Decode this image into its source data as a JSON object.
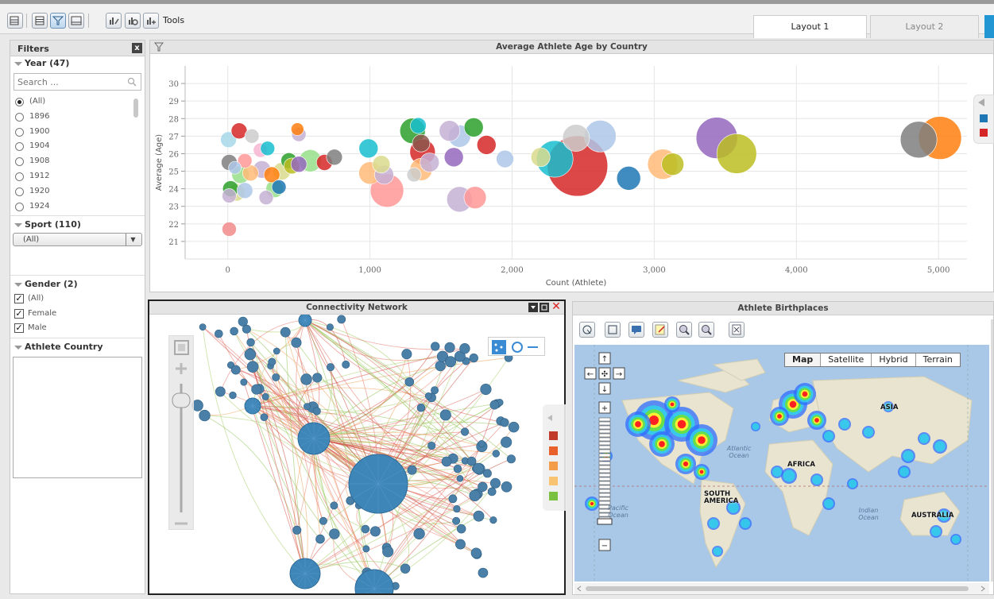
{
  "toolbar": {
    "tools_label": "Tools"
  },
  "tabs": [
    {
      "label": "Layout 1",
      "active": true
    },
    {
      "label": "Layout 2",
      "active": false
    }
  ],
  "filters": {
    "title": "Filters",
    "close": "x",
    "year": {
      "header": "Year (47)",
      "search_placeholder": "Search ...",
      "options": [
        "(All)",
        "1896",
        "1900",
        "1904",
        "1908",
        "1912",
        "1920",
        "1924"
      ],
      "selected": "(All)"
    },
    "sport": {
      "header": "Sport (110)",
      "selected": "(All)"
    },
    "gender": {
      "header": "Gender (2)",
      "options": [
        "(All)",
        "Female",
        "Male"
      ]
    },
    "athlete_country": {
      "header": "Athlete Country"
    }
  },
  "chart_panel": {
    "title": "Average Athlete Age by Country"
  },
  "chart_data": {
    "type": "scatter",
    "title": "Average Athlete Age by Country",
    "xlabel": "Count (Athlete)",
    "ylabel": "Average (Age)",
    "xlim": [
      -300,
      5200
    ],
    "ylim": [
      20,
      31
    ],
    "xticks": [
      0,
      1000,
      2000,
      3000,
      4000,
      5000
    ],
    "xtick_labels": [
      "0",
      "1,000",
      "2,000",
      "3,000",
      "4,000",
      "5,000"
    ],
    "yticks": [
      21,
      22,
      23,
      24,
      25,
      26,
      27,
      28,
      29,
      30
    ],
    "legend_colors": [
      "#1f77b4",
      "#d62728"
    ],
    "points": [
      {
        "x": 10,
        "y": 21.7,
        "r": 9,
        "color": "#f28b8b"
      },
      {
        "x": 5,
        "y": 26.8,
        "r": 10,
        "color": "#a8d8ea"
      },
      {
        "x": 80,
        "y": 27.3,
        "r": 10,
        "color": "#d62728"
      },
      {
        "x": 170,
        "y": 27.0,
        "r": 9,
        "color": "#cccccc"
      },
      {
        "x": 10,
        "y": 25.5,
        "r": 10,
        "color": "#7f7f7f"
      },
      {
        "x": 50,
        "y": 25.2,
        "r": 8,
        "color": "#aec7e8"
      },
      {
        "x": 120,
        "y": 25.6,
        "r": 9,
        "color": "#ff9896"
      },
      {
        "x": 230,
        "y": 26.2,
        "r": 9,
        "color": "#f7b6d2"
      },
      {
        "x": 280,
        "y": 26.3,
        "r": 9,
        "color": "#17becf"
      },
      {
        "x": 20,
        "y": 24.0,
        "r": 10,
        "color": "#2ca02c"
      },
      {
        "x": 90,
        "y": 24.8,
        "r": 11,
        "color": "#98df8a"
      },
      {
        "x": 160,
        "y": 24.9,
        "r": 10,
        "color": "#ffbb78"
      },
      {
        "x": 240,
        "y": 25.1,
        "r": 11,
        "color": "#c5b0d5"
      },
      {
        "x": 310,
        "y": 24.8,
        "r": 10,
        "color": "#ff7f0e"
      },
      {
        "x": 380,
        "y": 25.0,
        "r": 11,
        "color": "#dbdb8d"
      },
      {
        "x": 430,
        "y": 25.6,
        "r": 10,
        "color": "#2ca02c"
      },
      {
        "x": 450,
        "y": 25.3,
        "r": 10,
        "color": "#bcbd22"
      },
      {
        "x": 500,
        "y": 25.4,
        "r": 10,
        "color": "#9467bd"
      },
      {
        "x": 580,
        "y": 25.6,
        "r": 14,
        "color": "#98df8a"
      },
      {
        "x": 680,
        "y": 25.5,
        "r": 10,
        "color": "#d62728"
      },
      {
        "x": 750,
        "y": 25.8,
        "r": 10,
        "color": "#7f7f7f"
      },
      {
        "x": 500,
        "y": 27.1,
        "r": 9,
        "color": "#c5b0d5"
      },
      {
        "x": 490,
        "y": 27.4,
        "r": 8,
        "color": "#ff7f0e"
      },
      {
        "x": 330,
        "y": 24.0,
        "r": 11,
        "color": "#98df8a"
      },
      {
        "x": 360,
        "y": 24.1,
        "r": 9,
        "color": "#1f77b4"
      },
      {
        "x": 120,
        "y": 23.9,
        "r": 10,
        "color": "#aec7e8"
      },
      {
        "x": 270,
        "y": 23.5,
        "r": 9,
        "color": "#c5b0d5"
      },
      {
        "x": 60,
        "y": 23.8,
        "r": 11,
        "color": "#dbdb8d"
      },
      {
        "x": 10,
        "y": 23.6,
        "r": 9,
        "color": "#c5b0d5"
      },
      {
        "x": 990,
        "y": 26.3,
        "r": 12,
        "color": "#17becf"
      },
      {
        "x": 1000,
        "y": 24.9,
        "r": 14,
        "color": "#ffbb78"
      },
      {
        "x": 1080,
        "y": 25.4,
        "r": 11,
        "color": "#dbdb8d"
      },
      {
        "x": 1100,
        "y": 24.8,
        "r": 12,
        "color": "#c5b0d5"
      },
      {
        "x": 1120,
        "y": 23.9,
        "r": 21,
        "color": "#ff9896"
      },
      {
        "x": 1300,
        "y": 27.3,
        "r": 16,
        "color": "#2ca02c"
      },
      {
        "x": 1340,
        "y": 27.6,
        "r": 10,
        "color": "#17becf"
      },
      {
        "x": 1370,
        "y": 26.1,
        "r": 16,
        "color": "#d62728"
      },
      {
        "x": 1360,
        "y": 25.1,
        "r": 14,
        "color": "#ffbb78"
      },
      {
        "x": 1360,
        "y": 26.6,
        "r": 11,
        "color": "#8c564b"
      },
      {
        "x": 1420,
        "y": 25.5,
        "r": 12,
        "color": "#c5b0d5"
      },
      {
        "x": 1310,
        "y": 24.8,
        "r": 9,
        "color": "#cccccc"
      },
      {
        "x": 1560,
        "y": 27.3,
        "r": 13,
        "color": "#c5b0d5"
      },
      {
        "x": 1630,
        "y": 27.0,
        "r": 14,
        "color": "#aec7e8"
      },
      {
        "x": 1730,
        "y": 27.5,
        "r": 12,
        "color": "#2ca02c"
      },
      {
        "x": 1590,
        "y": 25.8,
        "r": 12,
        "color": "#9467bd"
      },
      {
        "x": 1820,
        "y": 26.5,
        "r": 12,
        "color": "#d62728"
      },
      {
        "x": 1630,
        "y": 23.4,
        "r": 16,
        "color": "#c5b0d5"
      },
      {
        "x": 1740,
        "y": 23.5,
        "r": 14,
        "color": "#ff9896"
      },
      {
        "x": 1950,
        "y": 25.7,
        "r": 11,
        "color": "#aec7e8"
      },
      {
        "x": 2200,
        "y": 25.8,
        "r": 12,
        "color": "#dbdb8d"
      },
      {
        "x": 2300,
        "y": 25.7,
        "r": 23,
        "color": "#17becf"
      },
      {
        "x": 2460,
        "y": 25.3,
        "r": 38,
        "color": "#d62728"
      },
      {
        "x": 2450,
        "y": 26.9,
        "r": 17,
        "color": "#cccccc"
      },
      {
        "x": 2620,
        "y": 27.0,
        "r": 20,
        "color": "#aec7e8"
      },
      {
        "x": 2820,
        "y": 24.6,
        "r": 15,
        "color": "#1f77b4"
      },
      {
        "x": 3060,
        "y": 25.4,
        "r": 19,
        "color": "#ffbb78"
      },
      {
        "x": 3130,
        "y": 25.4,
        "r": 14,
        "color": "#bcbd22"
      },
      {
        "x": 3440,
        "y": 26.9,
        "r": 26,
        "color": "#9467bd"
      },
      {
        "x": 3580,
        "y": 26.0,
        "r": 25,
        "color": "#bcbd22"
      },
      {
        "x": 4860,
        "y": 26.8,
        "r": 23,
        "color": "#7f7f7f"
      },
      {
        "x": 5010,
        "y": 26.9,
        "r": 27,
        "color": "#ff7f0e"
      }
    ]
  },
  "network_panel": {
    "title": "Connectivity Network",
    "legend_colors": [
      "#c0392b",
      "#e8602c",
      "#f39c4a",
      "#f8c471",
      "#7ac142"
    ]
  },
  "map_panel": {
    "title": "Athlete Birthplaces",
    "map_types": [
      "Map",
      "Satellite",
      "Hybrid",
      "Terrain"
    ],
    "selected_type": "Map",
    "labels": {
      "asia": "ASIA",
      "africa": "AFRICA",
      "south_america": "SOUTH AMERICA",
      "australia": "AUSTRALIA"
    },
    "oceans": {
      "atlantic": "Atlantic Ocean",
      "pacific": "Pacific Ocean",
      "indian": "Indian Ocean"
    }
  }
}
